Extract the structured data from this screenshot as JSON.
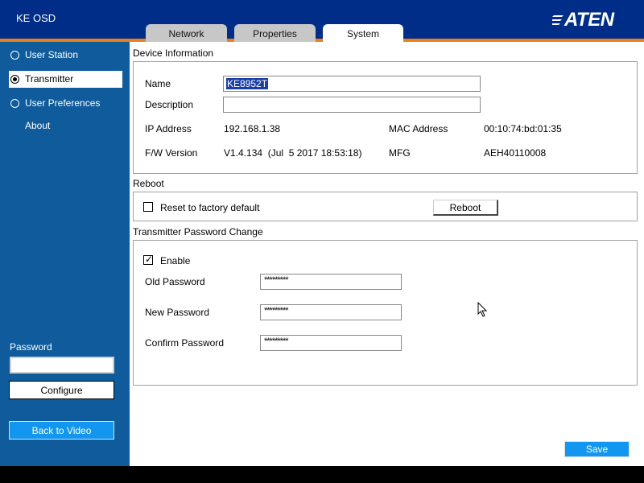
{
  "app": {
    "title": "KE OSD",
    "logo_text": "ATEN"
  },
  "tabs": [
    {
      "label": "Network"
    },
    {
      "label": "Properties"
    },
    {
      "label": "System"
    }
  ],
  "sidebar": {
    "items": [
      {
        "label": "User Station"
      },
      {
        "label": "Transmitter"
      },
      {
        "label": "User Preferences"
      },
      {
        "label": "About"
      }
    ],
    "password_label": "Password",
    "password_value": "",
    "configure_label": "Configure",
    "back_label": "Back to Video"
  },
  "device_info": {
    "title": "Device Information",
    "name_label": "Name",
    "name_value": "KE8952T",
    "description_label": "Description",
    "description_value": "",
    "ip_label": "IP Address",
    "ip_value": "192.168.1.38",
    "mac_label": "MAC Address",
    "mac_value": "00:10:74:bd:01:35",
    "fw_label": "F/W Version",
    "fw_value": "V1.4.134  (Jul  5 2017 18:53:18)",
    "mfg_label": "MFG",
    "mfg_value": "AEH40110008"
  },
  "reboot": {
    "title": "Reboot",
    "factory_label": "Reset to factory default",
    "factory_checked": false,
    "button_label": "Reboot"
  },
  "password_change": {
    "title": "Transmitter Password Change",
    "enable_label": "Enable",
    "enable_checked": true,
    "old_label": "Old Password",
    "old_value": "*********",
    "new_label": "New Password",
    "new_value": "*********",
    "confirm_label": "Confirm Password",
    "confirm_value": "*********"
  },
  "footer": {
    "save_label": "Save"
  },
  "colors": {
    "header": "#002d87",
    "accent_line": "#e8801e",
    "sidebar": "#0f5b9c",
    "button_blue": "#1296f0",
    "selection": "#1a3ea3"
  }
}
